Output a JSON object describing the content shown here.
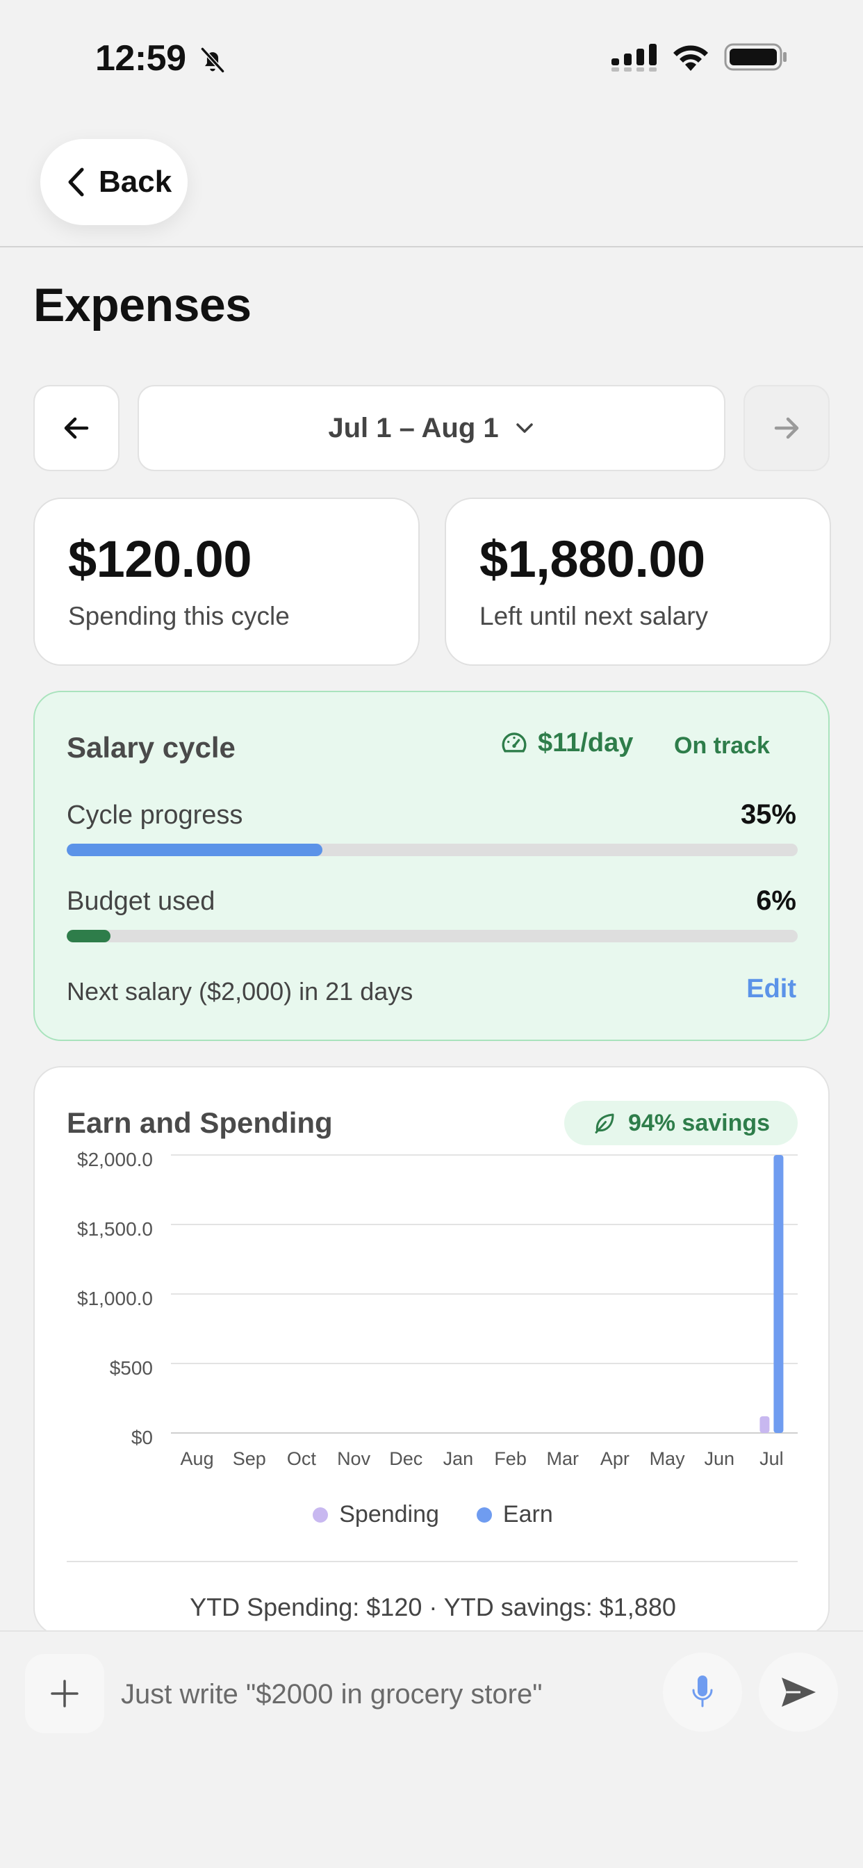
{
  "status_bar": {
    "time": "12:59"
  },
  "nav": {
    "back_label": "Back"
  },
  "page": {
    "title": "Expenses"
  },
  "period": {
    "label": "Jul 1 – Aug 1"
  },
  "stats": [
    {
      "amount": "$120.00",
      "label": "Spending this cycle"
    },
    {
      "amount": "$1,880.00",
      "label": "Left until next salary"
    }
  ],
  "salary_cycle": {
    "title": "Salary cycle",
    "daily_rate": "$11/day",
    "status": "On track",
    "cycle_progress_label": "Cycle progress",
    "cycle_progress_value": "35%",
    "cycle_progress_fraction": 0.35,
    "budget_used_label": "Budget used",
    "budget_used_value": "6%",
    "budget_used_fraction": 0.06,
    "next_salary_text": "Next salary ($2,000) in 21 days",
    "edit_label": "Edit",
    "colors": {
      "progress": "#5b93e8",
      "budget": "#2e7d4a",
      "status": "#2e7d4a"
    }
  },
  "earn_spending": {
    "title": "Earn and Spending",
    "savings_badge": "94% savings",
    "ytd_text": "YTD Spending: $120 · YTD savings: $1,880"
  },
  "chart_data": {
    "type": "bar",
    "categories": [
      "Aug",
      "Sep",
      "Oct",
      "Nov",
      "Dec",
      "Jan",
      "Feb",
      "Mar",
      "Apr",
      "May",
      "Jun",
      "Jul"
    ],
    "series": [
      {
        "name": "Spending",
        "color": "#c8b8f0",
        "values": [
          0,
          0,
          0,
          0,
          0,
          0,
          0,
          0,
          0,
          0,
          0,
          120
        ]
      },
      {
        "name": "Earn",
        "color": "#6f9cf0",
        "values": [
          0,
          0,
          0,
          0,
          0,
          0,
          0,
          0,
          0,
          0,
          0,
          2000
        ]
      }
    ],
    "y_ticks": [
      {
        "value": 2000,
        "label": "$2,000.0"
      },
      {
        "value": 1500,
        "label": "$1,500.0"
      },
      {
        "value": 1000,
        "label": "$1,000.0"
      },
      {
        "value": 500,
        "label": "$500"
      },
      {
        "value": 0,
        "label": "$0"
      }
    ],
    "ylim": [
      0,
      2000
    ],
    "grid": true,
    "legend_position": "bottom"
  },
  "composer": {
    "placeholder": "Just write \"$2000 in grocery store\""
  }
}
